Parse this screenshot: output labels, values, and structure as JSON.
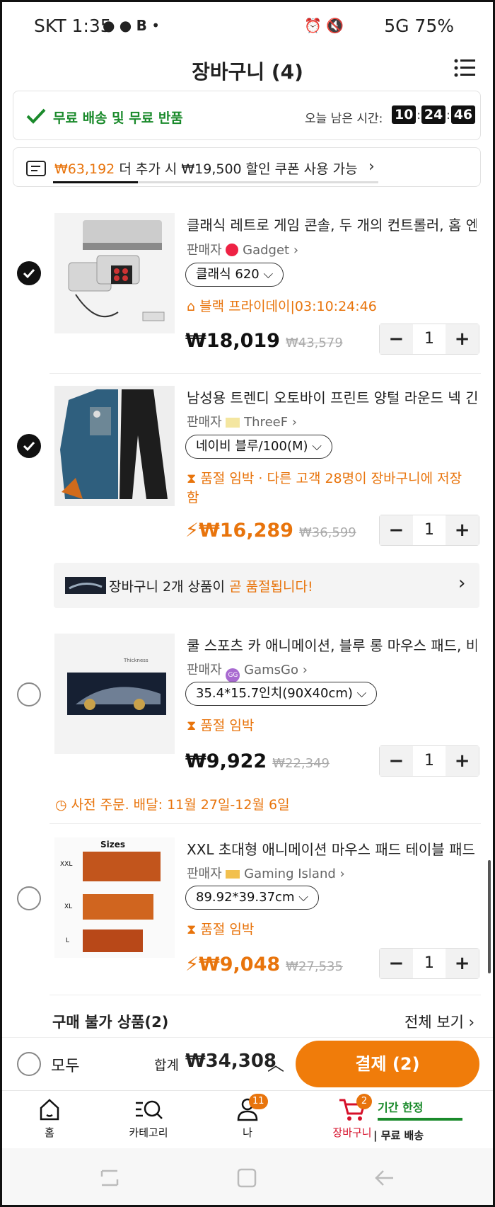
{
  "status_bar": {
    "carrier_time": "SKT 1:35",
    "right": "5G 75%"
  },
  "header": {
    "title": "장바구니 (4)"
  },
  "shipping_banner": {
    "text": "무료 배송 및 무료 반품",
    "timer_label": "오늘 남은 시간:",
    "hh": "10",
    "mm": "24",
    "ss": "46"
  },
  "coupon_banner": {
    "amount": "₩63,192",
    "text": " 더 추가 시 ₩19,500 할인 쿠폰 사용 가능",
    "progress": 0.26
  },
  "items": [
    {
      "title": "클래식 레트로 게임 콘솔, 두 개의 컨트롤러, 홈 엔...",
      "seller_label": "판매자",
      "seller": "Gadget",
      "option": "클래식 620",
      "tag": "블랙 프라이데이|03:10:24:46",
      "price": "₩18,019",
      "orig": "₩43,579",
      "qty": "1",
      "checked": true
    },
    {
      "title": "남성용 트렌디 오토바이 프린트 양털 라운드 넥 긴...",
      "seller_label": "판매자",
      "seller": "ThreeF",
      "option": "네이비 블루/100(M)",
      "tag": "품절 임박 · 다른 고객 28명이 장바구니에 저장",
      "tag2": "함",
      "price": "₩16,289",
      "orig": "₩36,599",
      "qty": "1",
      "checked": true
    },
    {
      "title": "쿨 스포츠 카 애니메이션, 블루 롱 마우스 패드, 비...",
      "seller_label": "판매자",
      "seller": "GamsGo",
      "option": "35.4*15.7인치(90X40cm)",
      "tag": "품절 임박",
      "price": "₩9,922",
      "orig": "₩22,349",
      "qty": "1",
      "checked": false
    },
    {
      "title": "XXL 초대형 애니메이션 마우스 패드 테이블 패드...",
      "seller_label": "판매자",
      "seller": "Gaming Island",
      "option": "89.92*39.37cm",
      "tag": "품절 임박",
      "price": "₩9,048",
      "orig": "₩27,535",
      "qty": "1",
      "checked": false
    }
  ],
  "soldout_notice": {
    "text": "장바구니 2개 상품이 ",
    "highlight": "곧 품절됩니다!"
  },
  "preorder": {
    "text": "사전 주문. 배달: 11월 27일-12월 6일"
  },
  "unavailable": {
    "title": "구매 불가 상품(2)",
    "view_all": "전체 보기"
  },
  "bottom": {
    "all_label": "모두",
    "total_label": "합계",
    "total": "₩34,308",
    "checkout": "결제 (2)"
  },
  "nav": {
    "home": "홈",
    "category": "카테고리",
    "me": "나",
    "me_badge": "11",
    "cart": "장바구니",
    "cart_badge": "2",
    "promo_top": "기간 한정",
    "promo_bottom": "무료 배송"
  },
  "colors": {
    "accent": "#e8740c",
    "green": "#1a8a2b"
  }
}
